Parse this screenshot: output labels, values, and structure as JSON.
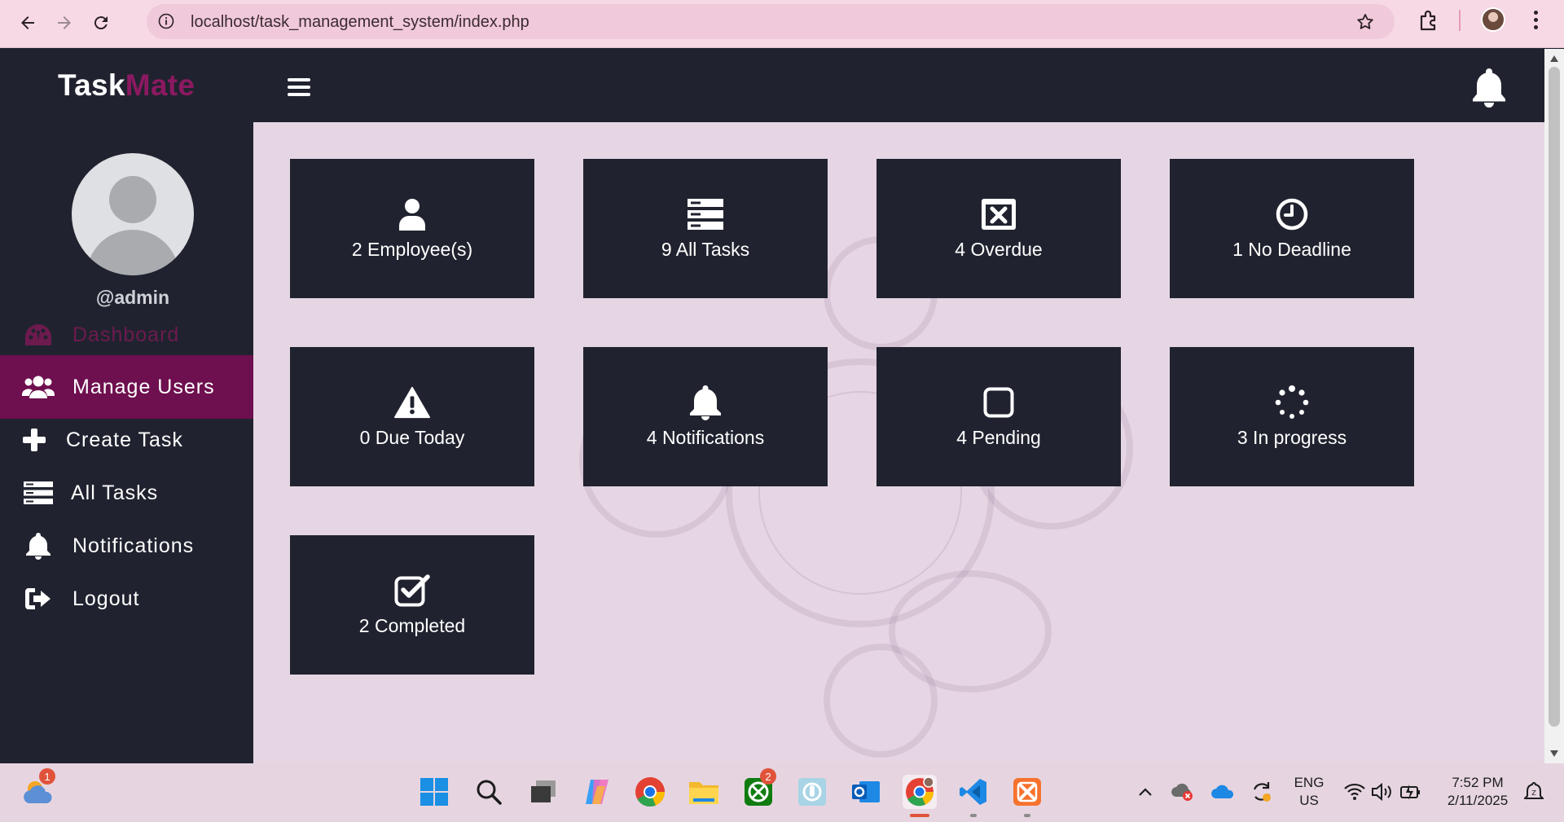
{
  "browser": {
    "url": "localhost/task_management_system/index.php"
  },
  "app": {
    "brand_part1": "Task",
    "brand_part2": "Mate",
    "accent_color": "#8b1961",
    "dark_color": "#20232f"
  },
  "sidebar": {
    "username": "@admin",
    "items": [
      {
        "label": "Dashboard",
        "icon": "tachometer-icon"
      },
      {
        "label": "Manage Users",
        "icon": "users-icon",
        "active": true
      },
      {
        "label": "Create Task",
        "icon": "plus-icon"
      },
      {
        "label": "All Tasks",
        "icon": "tasks-list-icon"
      },
      {
        "label": "Notifications",
        "icon": "bell-icon"
      },
      {
        "label": "Logout",
        "icon": "sign-out-icon"
      }
    ]
  },
  "dashboard": {
    "cards": [
      {
        "label": "2 Employee(s)",
        "icon": "user-icon"
      },
      {
        "label": "9 All Tasks",
        "icon": "tasks-list-icon"
      },
      {
        "label": "4 Overdue",
        "icon": "window-close-icon"
      },
      {
        "label": "1 No Deadline",
        "icon": "clock-icon"
      },
      {
        "label": "0 Due Today",
        "icon": "warning-icon"
      },
      {
        "label": "4 Notifications",
        "icon": "bell-icon"
      },
      {
        "label": "4 Pending",
        "icon": "square-icon"
      },
      {
        "label": "3 In progress",
        "icon": "spinner-icon"
      },
      {
        "label": "2 Completed",
        "icon": "check-square-icon"
      }
    ]
  },
  "taskbar": {
    "weather_badge": "1",
    "xbox_badge": "2",
    "lang_line1": "ENG",
    "lang_line2": "US",
    "time": "7:52 PM",
    "date": "2/11/2025"
  }
}
